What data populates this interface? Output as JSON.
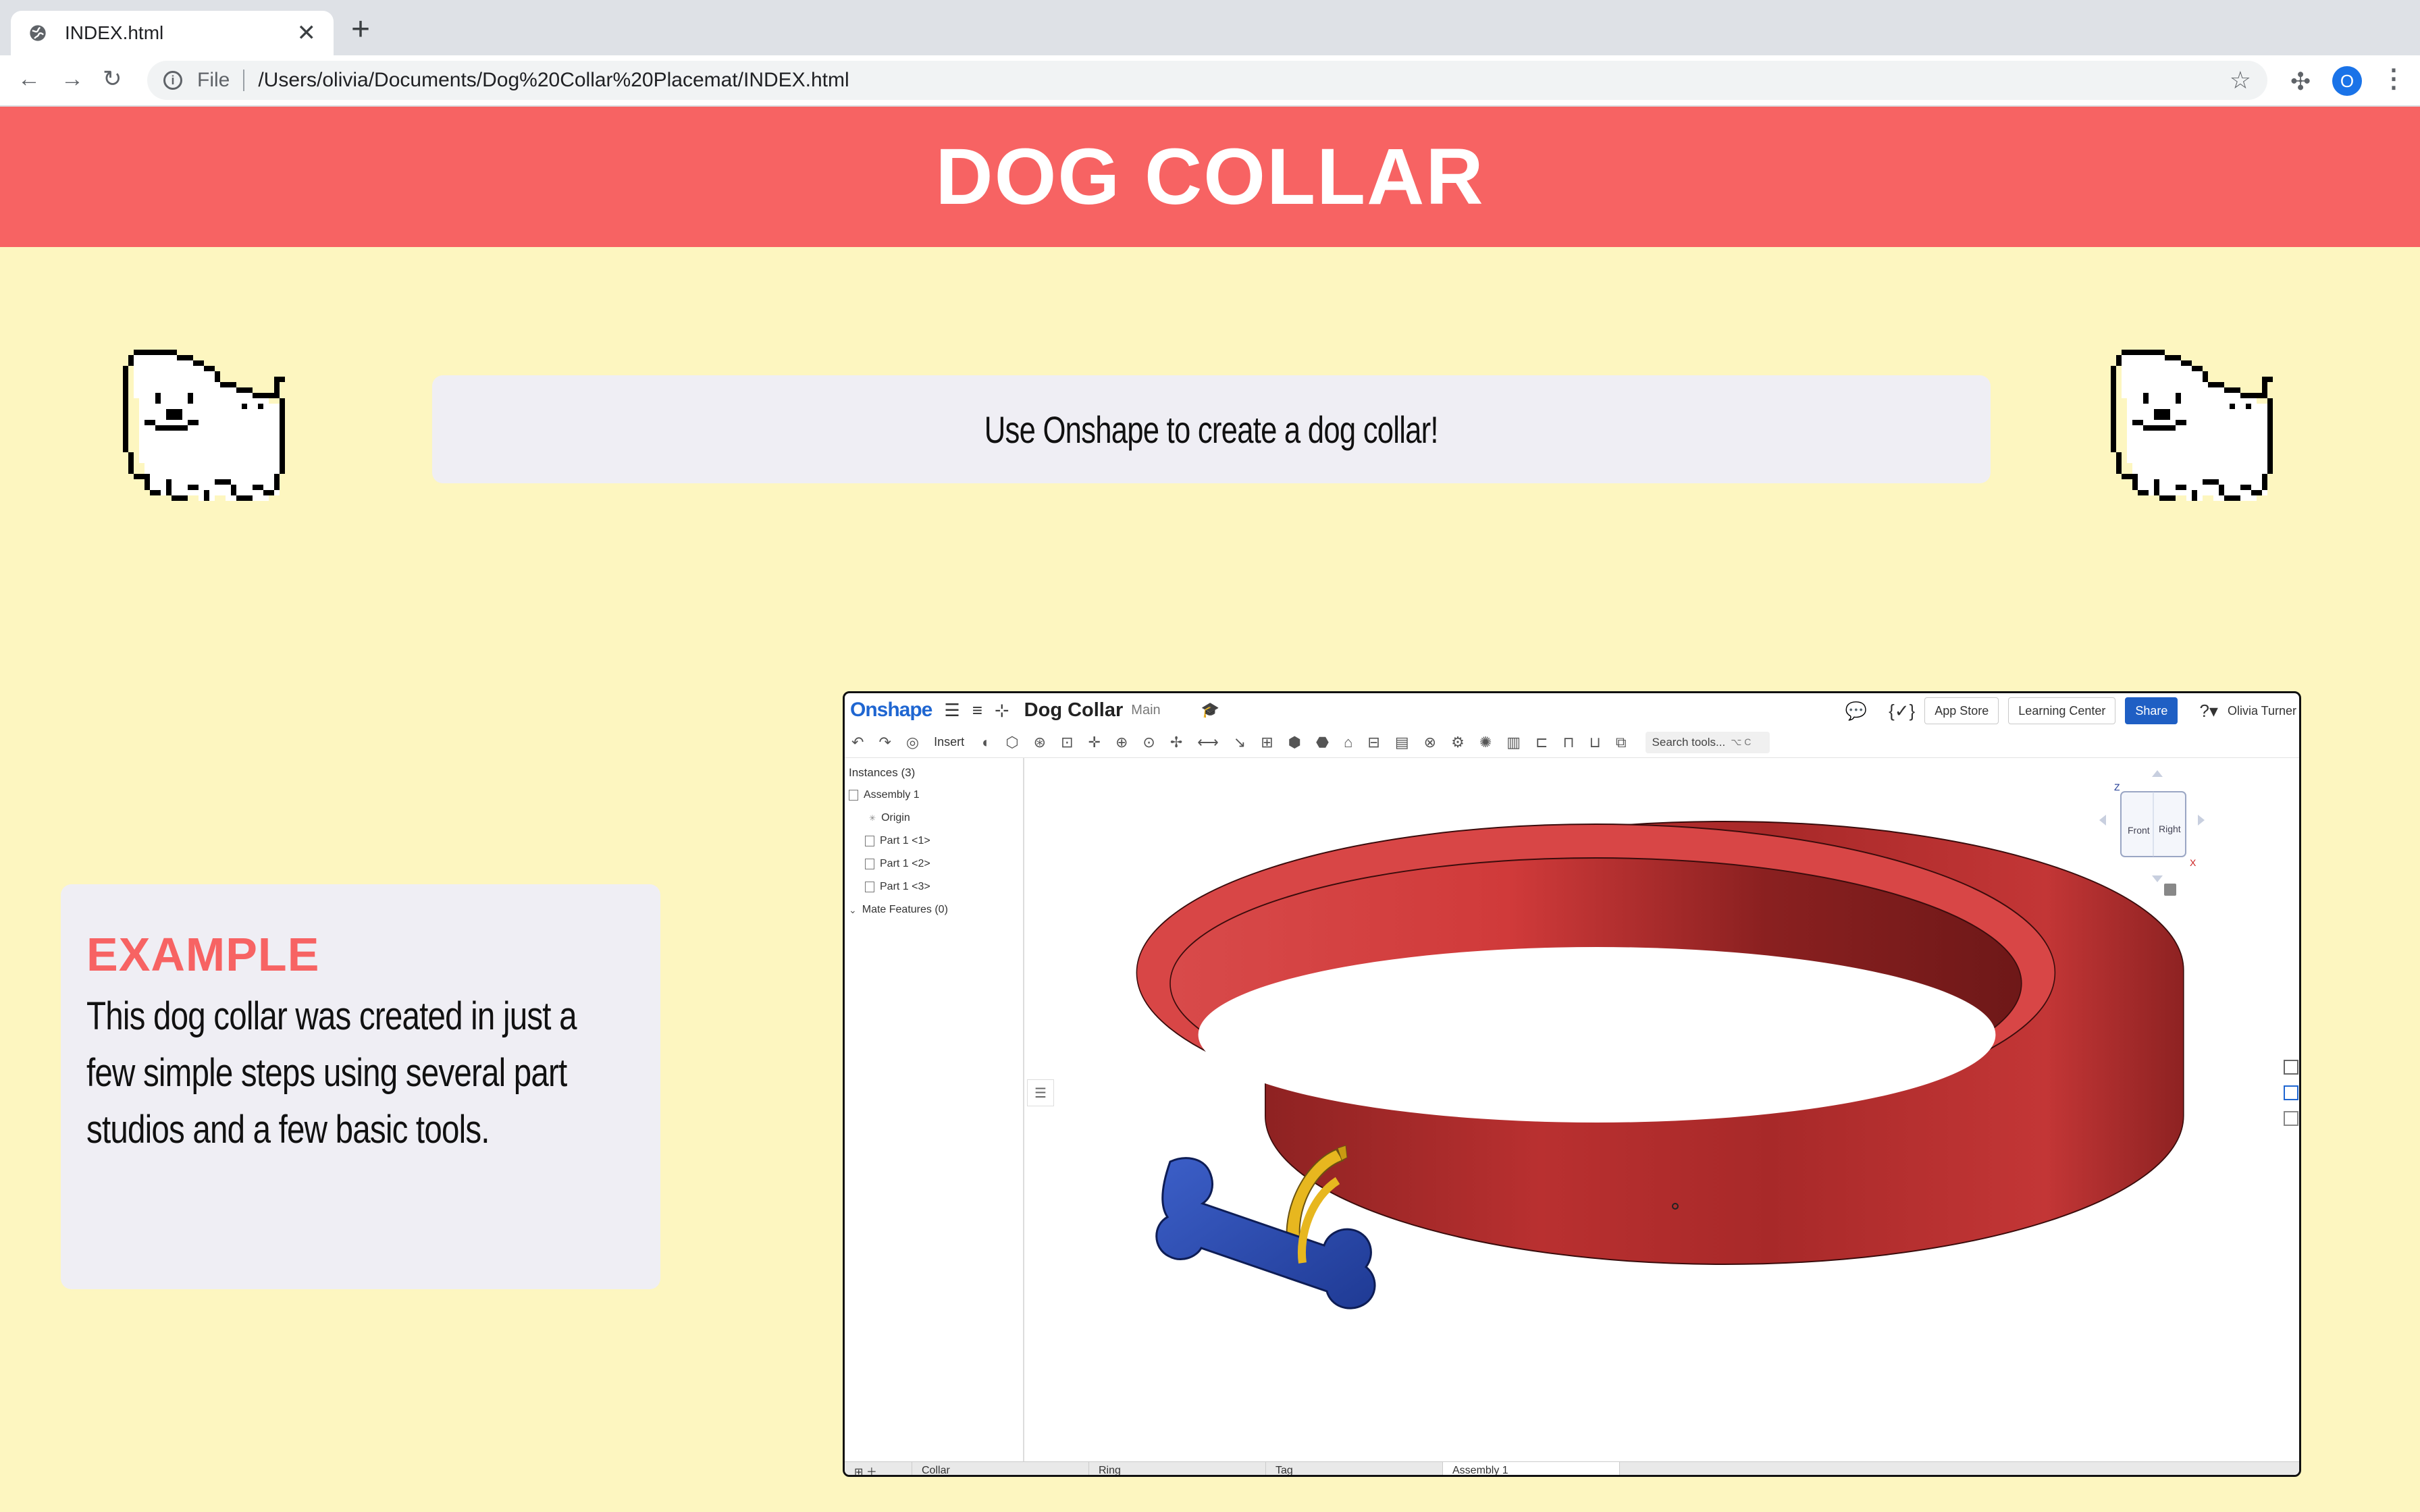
{
  "browser": {
    "tab_title": "INDEX.html",
    "new_tab_label": "+",
    "scheme": "File",
    "url": "/Users/olivia/Documents/Dog%20Collar%20Placemat/INDEX.html",
    "profile_initial": "O"
  },
  "page": {
    "banner_title": "DOG COLLAR",
    "intro_text": "Use Onshape to create a dog collar!",
    "example_heading": "EXAMPLE",
    "example_text": "This dog collar was created in just a few simple steps using several part studios and a few basic tools."
  },
  "onshape": {
    "logo": "Onshape",
    "doc_title": "Dog Collar",
    "branch": "Main",
    "app_store": "App Store",
    "learning_center": "Learning Center",
    "share": "Share",
    "user": "Olivia Turner",
    "insert": "Insert",
    "search_placeholder": "Search tools...",
    "search_shortcut": "⌥ C",
    "instances_header": "Instances (3)",
    "tree": {
      "assembly": "Assembly 1",
      "origin": "Origin",
      "part1": "Part 1 <1>",
      "part2": "Part 1 <2>",
      "part3": "Part 1 <3>",
      "mates": "Mate Features (0)"
    },
    "viewcube": {
      "front": "Front",
      "right": "Right",
      "z": "Z",
      "x": "X"
    },
    "tabs": [
      "Collar",
      "Ring",
      "Tag",
      "Assembly 1"
    ]
  },
  "colors": {
    "banner": "#f76363",
    "page_bg": "#fdf6c0",
    "collar_red": "#d03a3a",
    "tag_blue": "#2a4aa8",
    "ring_gold": "#e0b020"
  }
}
